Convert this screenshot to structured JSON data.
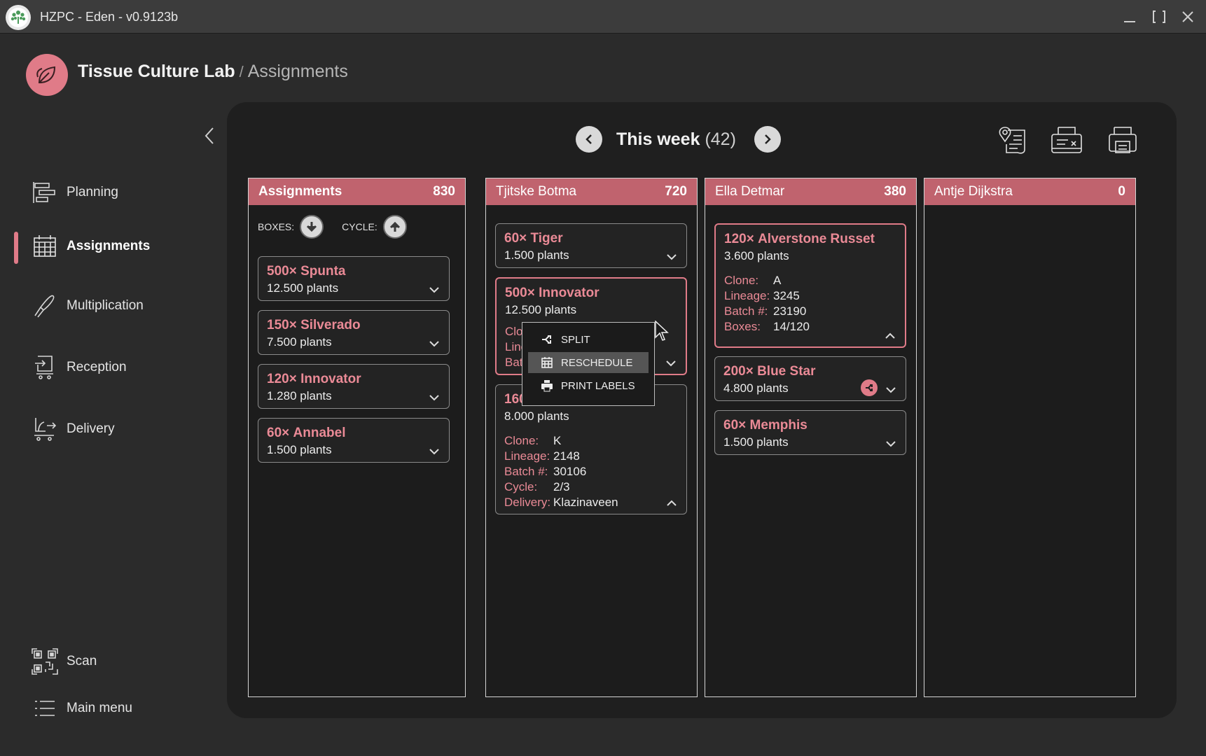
{
  "window": {
    "title": "HZPC - Eden - v0.9123b"
  },
  "header": {
    "lab": "Tissue Culture Lab",
    "separator": "/",
    "page": "Assignments"
  },
  "sidebar": {
    "items": [
      {
        "label": "Planning",
        "icon": "planning-icon",
        "active": false
      },
      {
        "label": "Assignments",
        "icon": "calendar-grid-icon",
        "active": true
      },
      {
        "label": "Multiplication",
        "icon": "scalpel-icon",
        "active": false
      },
      {
        "label": "Reception",
        "icon": "reception-icon",
        "active": false
      },
      {
        "label": "Delivery",
        "icon": "delivery-icon",
        "active": false
      }
    ],
    "bottom": [
      {
        "label": "Scan",
        "icon": "qr-icon"
      },
      {
        "label": "Main menu",
        "icon": "menu-icon"
      }
    ]
  },
  "week": {
    "label": "This week",
    "count": "(42)"
  },
  "toolbar": {
    "icons": [
      "map-pin-list-icon",
      "label-printer-icon",
      "printer-icon"
    ]
  },
  "columns": [
    {
      "title": "Assignments",
      "count": "830",
      "sort": {
        "boxes_label": "BOXES:",
        "cycle_label": "CYCLE:"
      },
      "cards": [
        {
          "qty": "500×",
          "name": "Spunta",
          "plants": "12.500 plants"
        },
        {
          "qty": "150×",
          "name": "Silverado",
          "plants": "7.500 plants"
        },
        {
          "qty": "120×",
          "name": "Innovator",
          "plants": "1.280 plants"
        },
        {
          "qty": "60×",
          "name": "Annabel",
          "plants": "1.500 plants"
        }
      ]
    },
    {
      "title": "Tjitske Botma",
      "count": "720",
      "cards": [
        {
          "qty": "60×",
          "name": "Tiger",
          "plants": "1.500 plants"
        },
        {
          "qty": "500×",
          "name": "Innovator",
          "plants": "12.500 plants",
          "partial": [
            "Clo",
            "Line",
            "Bat"
          ]
        },
        {
          "qty": "160",
          "name": "",
          "plants": "8.000 plants",
          "details": [
            {
              "k": "Clone:",
              "v": "K"
            },
            {
              "k": "Lineage:",
              "v": "2148"
            },
            {
              "k": "Batch #:",
              "v": "30106"
            },
            {
              "k": "Cycle:",
              "v": "2/3"
            },
            {
              "k": "Delivery:",
              "v": "Klazinaveen"
            }
          ]
        }
      ]
    },
    {
      "title": "Ella Detmar",
      "count": "380",
      "cards": [
        {
          "qty": "120×",
          "name": "Alverstone Russet",
          "plants": "3.600 plants",
          "details": [
            {
              "k": "Clone:",
              "v": "A"
            },
            {
              "k": "Lineage:",
              "v": "3245"
            },
            {
              "k": "Batch #:",
              "v": "23190"
            },
            {
              "k": "Boxes:",
              "v": "14/120"
            }
          ]
        },
        {
          "qty": "200×",
          "name": "Blue Star",
          "plants": "4.800 plants"
        },
        {
          "qty": "60×",
          "name": "Memphis",
          "plants": "1.500 plants"
        }
      ]
    },
    {
      "title": "Antje Dijkstra",
      "count": "0",
      "cards": []
    }
  ],
  "context_menu": {
    "items": [
      {
        "label": "SPLIT",
        "icon": "split-icon"
      },
      {
        "label": "RESCHEDULE",
        "icon": "calendar-icon",
        "highlighted": true
      },
      {
        "label": "PRINT LABELS",
        "icon": "printer-icon"
      }
    ]
  },
  "colors": {
    "accent": "#e07b88",
    "header_red": "#c0636e",
    "panel": "#1f1f1f",
    "background": "#2b2b2b"
  }
}
